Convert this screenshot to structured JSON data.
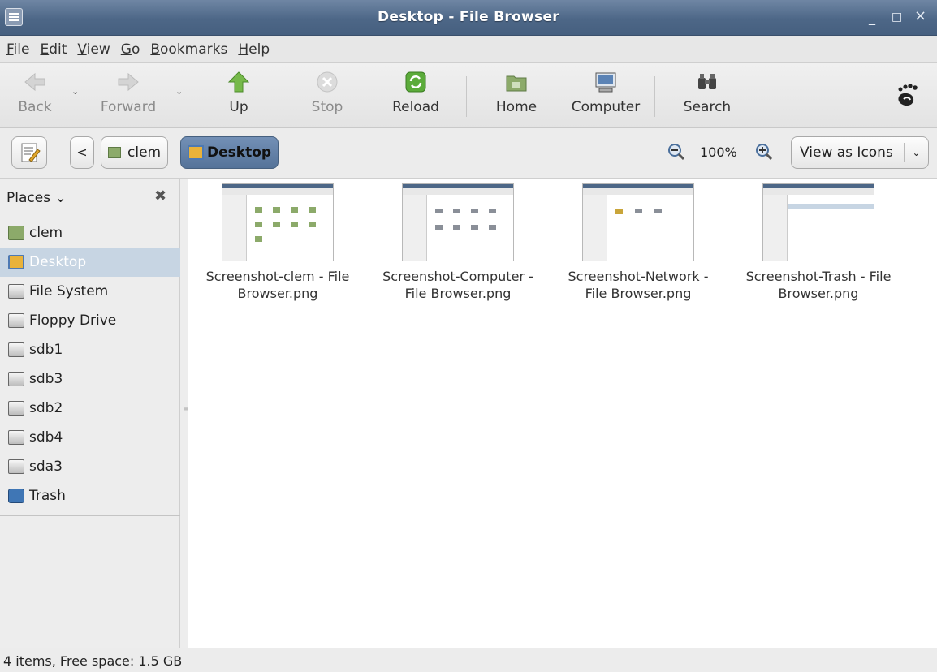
{
  "window": {
    "title": "Desktop - File Browser",
    "minimize": "_",
    "maximize": "□",
    "close": "×"
  },
  "menubar": {
    "items": [
      {
        "u": "F",
        "rest": "ile"
      },
      {
        "u": "E",
        "rest": "dit"
      },
      {
        "u": "V",
        "rest": "iew"
      },
      {
        "u": "G",
        "rest": "o"
      },
      {
        "u": "B",
        "rest": "ookmarks"
      },
      {
        "u": "H",
        "rest": "elp"
      }
    ]
  },
  "toolbar": {
    "back": "Back",
    "forward": "Forward",
    "up": "Up",
    "stop": "Stop",
    "reload": "Reload",
    "home": "Home",
    "computer": "Computer",
    "search": "Search",
    "dropdown_glyph": "⌄"
  },
  "location": {
    "back_glyph": "<",
    "crumbs": [
      "clem",
      "Desktop"
    ],
    "zoom": "100%",
    "view_mode": "View as Icons",
    "view_arrow": "⌄"
  },
  "sidebar": {
    "header": "Places ⌄",
    "close_glyph": "✖",
    "places": [
      {
        "label": "clem",
        "icon": "folder-icon"
      },
      {
        "label": "Desktop",
        "icon": "desktop-icon"
      },
      {
        "label": "File System",
        "icon": "drive-icon"
      },
      {
        "label": "Floppy Drive",
        "icon": "drive-icon"
      },
      {
        "label": "sdb1",
        "icon": "drive-icon"
      },
      {
        "label": "sdb3",
        "icon": "drive-icon"
      },
      {
        "label": "sdb2",
        "icon": "drive-icon"
      },
      {
        "label": "sdb4",
        "icon": "drive-icon"
      },
      {
        "label": "sda3",
        "icon": "drive-icon"
      },
      {
        "label": "Trash",
        "icon": "trash-icon"
      }
    ]
  },
  "files": [
    {
      "name": "Screenshot-clem - File Browser.png"
    },
    {
      "name": "Screenshot-Computer - File Browser.png"
    },
    {
      "name": "Screenshot-Network - File Browser.png"
    },
    {
      "name": "Screenshot-Trash - File Browser.png"
    }
  ],
  "status": "4 items, Free space: 1.5 GB"
}
